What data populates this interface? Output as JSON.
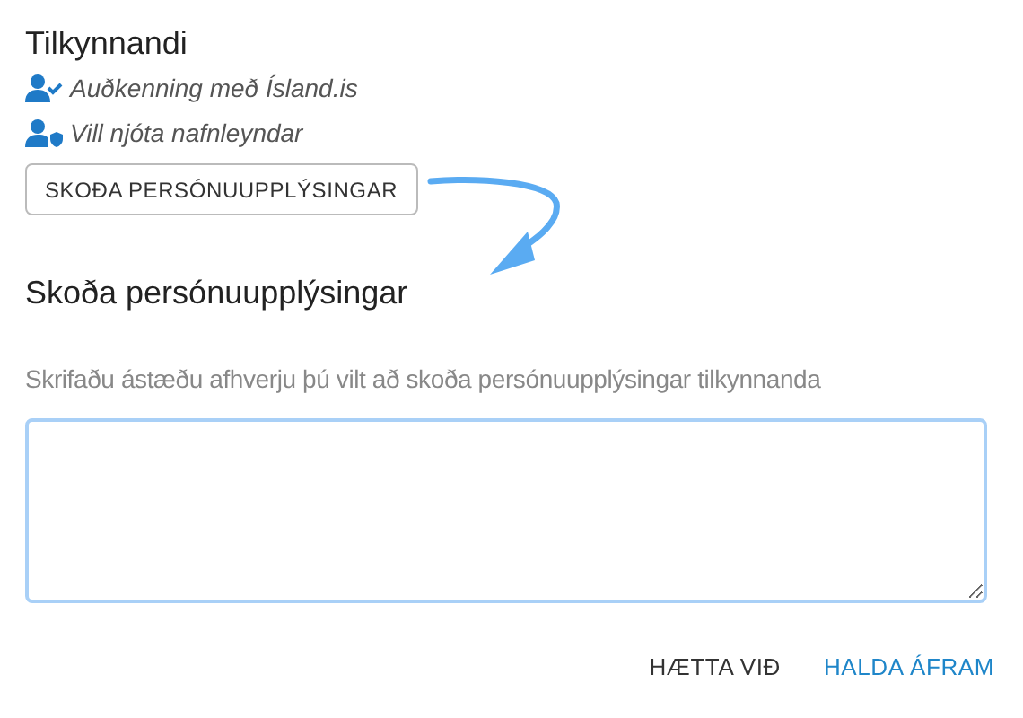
{
  "reporter": {
    "title": "Tilkynnandi",
    "lines": [
      {
        "kind": "verified",
        "text": "Auðkenning með Ísland.is"
      },
      {
        "kind": "anonymous",
        "text": "Vill njóta nafnleyndar"
      }
    ],
    "button": "SKOÐA PERSÓNUUPPLÝSINGAR"
  },
  "dialog": {
    "title": "Skoða persónuupplýsingar",
    "field_label": "Skrifaðu ástæðu afhverju þú vilt að skoða persónuupplýsingar tilkynnanda"
  },
  "actions": [
    {
      "kind": "cancel",
      "label": "HÆTTA VIÐ"
    },
    {
      "kind": "confirm",
      "label": "HALDA ÁFRAM"
    }
  ]
}
